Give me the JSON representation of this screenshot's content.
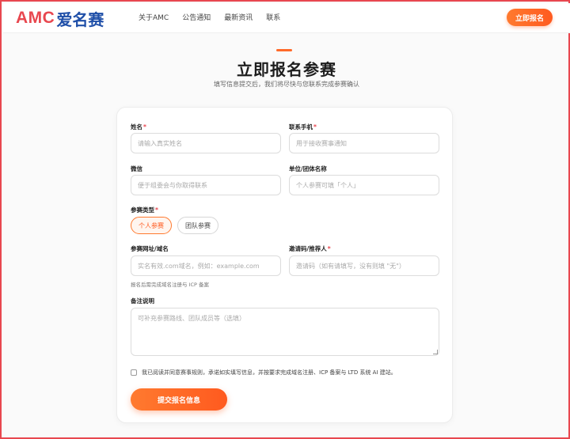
{
  "header": {
    "logo_latin": "AMC",
    "logo_cn": "爱名赛",
    "nav": [
      "关于AMC",
      "公告通知",
      "最新资讯",
      "联系"
    ],
    "cta_label": "立即报名"
  },
  "hero": {
    "title": "立即报名参赛",
    "subtitle": "填写信息提交后，我们将尽快与您联系完成参赛确认"
  },
  "form": {
    "name": {
      "label": "姓名",
      "required": "*",
      "placeholder": "请输入真实姓名",
      "value": ""
    },
    "phone": {
      "label": "联系手机",
      "required": "*",
      "placeholder": "用于接收赛事通知",
      "value": ""
    },
    "wechat": {
      "label": "微信",
      "placeholder": "便于组委会与你取得联系",
      "value": ""
    },
    "org": {
      "label": "单位/团体名称",
      "placeholder": "个人参赛可填「个人」",
      "value": ""
    },
    "type": {
      "label": "参赛类型",
      "required": "*",
      "options": [
        "个人参赛",
        "团队参赛"
      ],
      "selected": "个人参赛"
    },
    "site": {
      "label": "参赛网址/域名",
      "placeholder": "实名有效.com域名，例如：example.com",
      "value": "",
      "hint": "报名后需完成域名注册与 ICP 备案"
    },
    "invite": {
      "label": "邀请码/推荐人",
      "required": "*",
      "placeholder": "邀请码（如有请填写，没有则填 \"无\"）",
      "value": ""
    },
    "notes": {
      "label": "备注说明",
      "placeholder": "可补充参赛路线、团队成员等（选填）",
      "value": ""
    },
    "agree_text": "我已阅读并同意赛事规则，承诺如实填写信息，并按要求完成域名注册、ICP 备案与 LTD 系统 AI 建站。",
    "agree_checked": false,
    "submit_label": "提交报名信息"
  },
  "colors": {
    "accent": "#ff6a2a",
    "brand_red": "#e8474f",
    "brand_blue": "#1f4fa8"
  }
}
